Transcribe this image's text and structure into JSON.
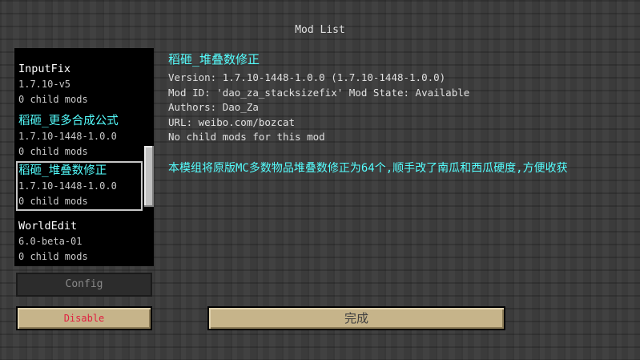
{
  "screen": {
    "title": "Mod List"
  },
  "mod_list": {
    "items": [
      {
        "name": "InputFix",
        "version": "1.7.10-v5",
        "children": "0 child mods"
      },
      {
        "name": "稻砸_更多合成公式",
        "version": "1.7.10-1448-1.0.0",
        "children": "0 child mods"
      },
      {
        "name": "稻砸_堆叠数修正",
        "version": "1.7.10-1448-1.0.0",
        "children": "0 child mods"
      },
      {
        "name": "WorldEdit",
        "version": "6.0-beta-01",
        "children": "0 child mods"
      }
    ],
    "selected_index": 2
  },
  "details": {
    "title": "稻砸_堆叠数修正",
    "version": "Version: 1.7.10-1448-1.0.0 (1.7.10-1448-1.0.0)",
    "mod_id": "Mod ID: 'dao_za_stacksizefix' Mod State: Available",
    "authors": "Authors: Dao_Za",
    "url": "URL: weibo.com/bozcat",
    "children": "No child mods for this mod",
    "description": "本模组将原版MC多数物品堆叠数修正为64个,顺手改了南瓜和西瓜硬度,方便收获"
  },
  "buttons": {
    "config": "Config",
    "disable": "Disable",
    "done": "完成"
  },
  "colors": {
    "mod_title_cyan": "#55ffff",
    "disable_text": "#e02040",
    "button_face": "#c6b48a"
  }
}
